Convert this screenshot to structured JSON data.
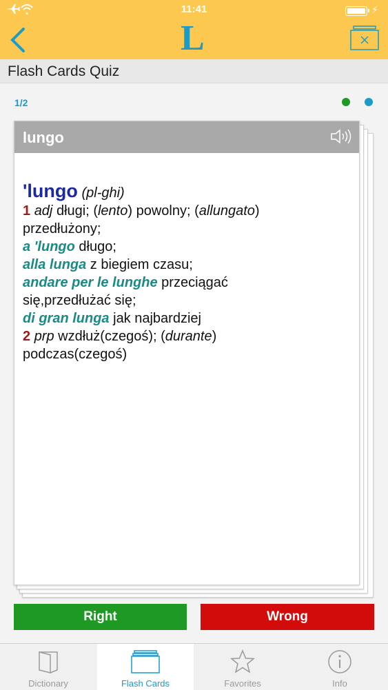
{
  "status": {
    "time": "11:41"
  },
  "header": {
    "logo": "L",
    "back_icon": "chevron-left-icon",
    "close_icon": "close-cards-icon"
  },
  "page": {
    "title": "Flash Cards Quiz"
  },
  "quiz": {
    "counter": "1/2",
    "dot_colors": [
      "#1e9a24",
      "#1a9bc8"
    ]
  },
  "card": {
    "headword": "lungo",
    "entry": {
      "head": "'lungo",
      "plural": "(pl-ghi)",
      "sense1_num": "1",
      "sense1_pos": "adj",
      "sense1_t1": "długi; (",
      "sense1_i1": "lento",
      "sense1_t2": ") powolny; (",
      "sense1_i2": "allungato",
      "sense1_t3": ")",
      "sense1_t4": "przedłużony;",
      "phrase1": "a 'lungo",
      "phrase1_t": " długo;",
      "phrase2": "alla lunga",
      "phrase2_t": " z biegiem czasu;",
      "phrase3": "andare per le lunghe",
      "phrase3_t": " przeciągać",
      "phrase3_t2": "się,przedłużać się;",
      "phrase4": "di gran lunga",
      "phrase4_t": " jak najbardziej",
      "sense2_num": "2",
      "sense2_pos": "prp",
      "sense2_t1": " wzdłuż(czegoś); (",
      "sense2_i1": "durante",
      "sense2_t2": ")",
      "sense2_t3": "podczas(czegoś)"
    }
  },
  "buttons": {
    "right": "Right",
    "wrong": "Wrong",
    "right_color": "#1e9a24",
    "wrong_color": "#d20b0b"
  },
  "tabs": [
    {
      "label": "Dictionary",
      "icon": "book-icon",
      "active": false
    },
    {
      "label": "Flash Cards",
      "icon": "flash-cards-icon",
      "active": true
    },
    {
      "label": "Favorites",
      "icon": "star-icon",
      "active": false
    },
    {
      "label": "Info",
      "icon": "info-icon",
      "active": false
    }
  ],
  "colors": {
    "brand_yellow": "#fdc84f",
    "accent_blue": "#1a9bc8"
  }
}
